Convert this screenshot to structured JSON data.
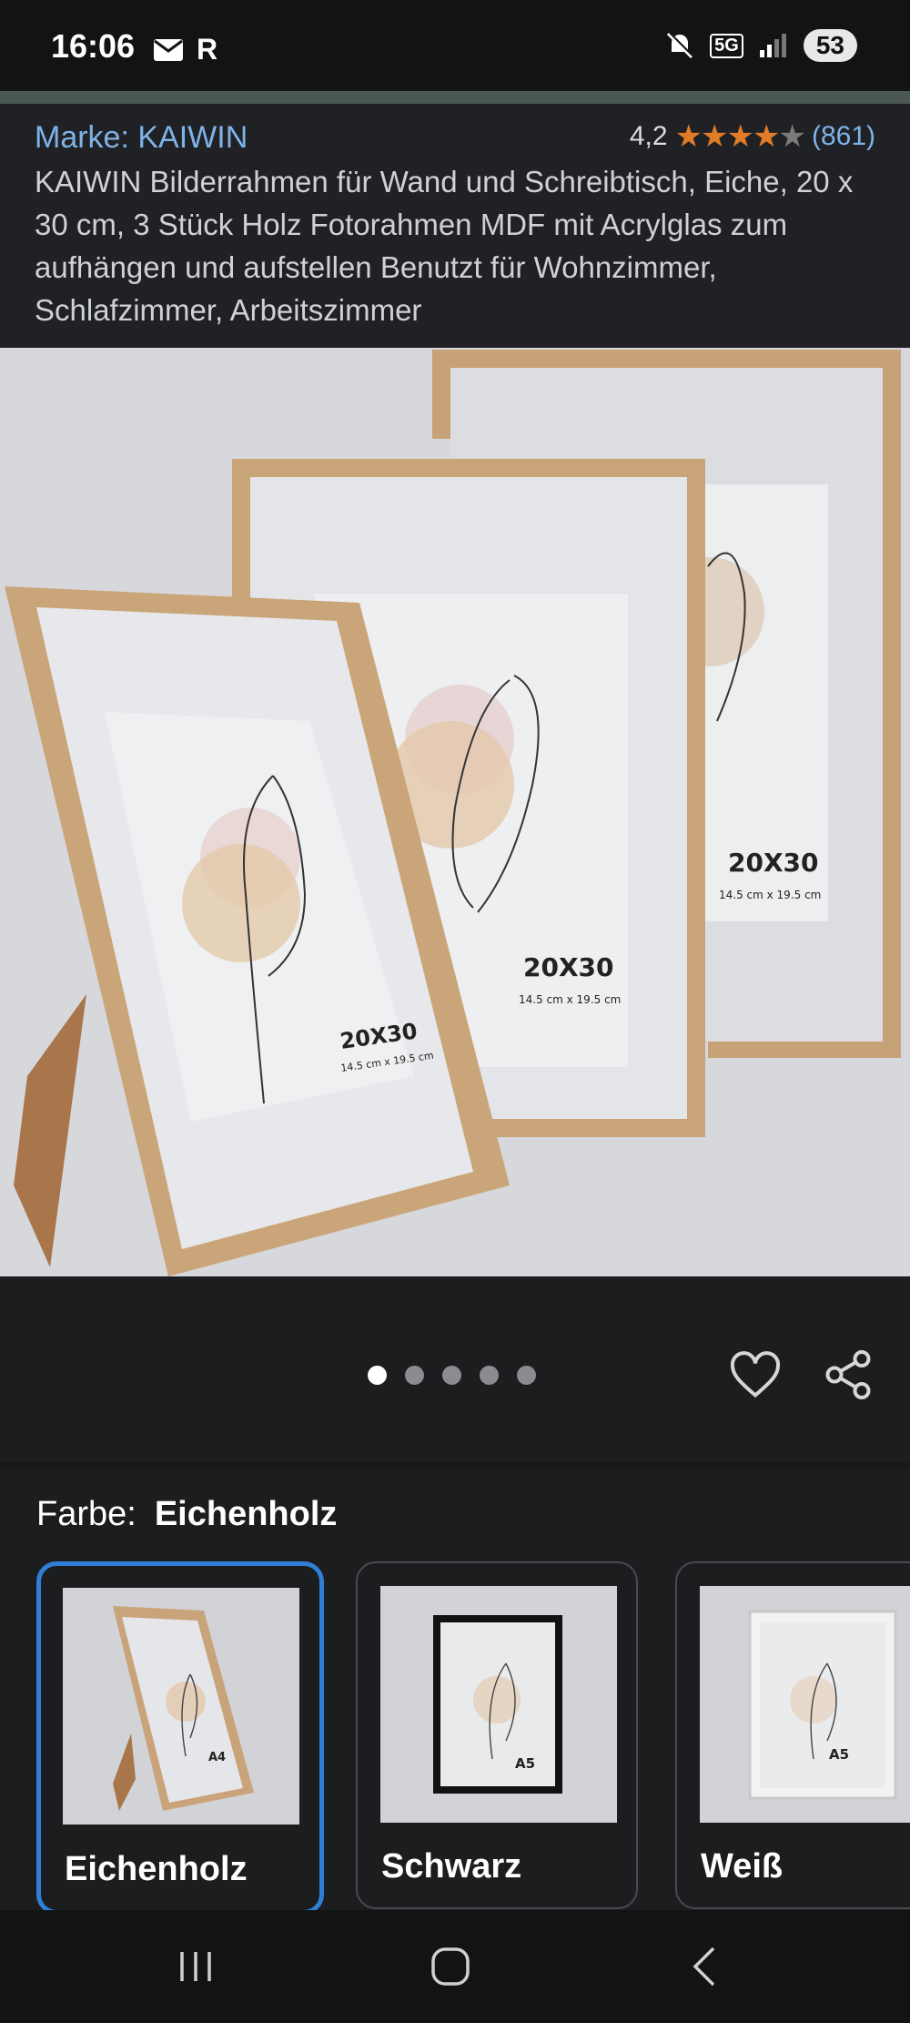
{
  "status_bar": {
    "time": "16:06",
    "left_icons": [
      "mail-icon",
      "r-icon"
    ],
    "network": "5G",
    "battery": "53"
  },
  "header": {
    "brand": "Marke: KAIWIN",
    "rating_value": "4,2",
    "rating_stars": 4.2,
    "rating_count": "(861)",
    "title": "KAIWIN Bilderrahmen für Wand und Schreibtisch, Eiche, 20 x 30 cm, 3 Stück Holz Fotorahmen MDF mit Acrylglas zum aufhängen und aufstellen Benutzt für Wohnzimmer, Schlafzimmer, Arbeitszimmer"
  },
  "product_image": {
    "frame_label": "20X30",
    "frame_sublabel": "14.5 cm x 19.5 cm"
  },
  "gallery": {
    "count": 5,
    "active_index": 0
  },
  "color_selector": {
    "label": "Farbe:",
    "selected": "Eichenholz",
    "options": [
      {
        "name": "Eichenholz",
        "size_label": "A4"
      },
      {
        "name": "Schwarz",
        "size_label": "A5"
      },
      {
        "name": "Weiß",
        "size_label": "A5"
      }
    ]
  },
  "colors": {
    "accent_link": "#7fb3e8",
    "star": "#e07b28",
    "selected_border": "#2f7fd6"
  }
}
